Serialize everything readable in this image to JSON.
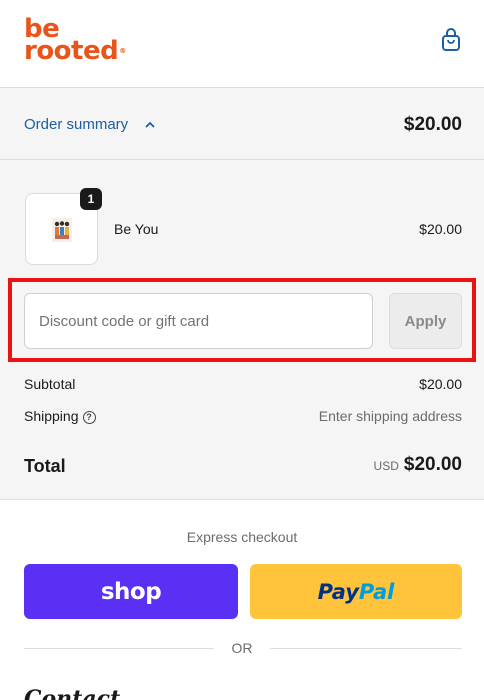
{
  "header": {
    "logo_line1": "be",
    "logo_line2": "rooted",
    "logo_reg": "®",
    "bag_icon": "shopping-bag-icon"
  },
  "order_summary": {
    "toggle_label": "Order summary",
    "toggle_icon": "chevron-up-icon",
    "total": "$20.00",
    "item": {
      "name": "Be You",
      "price": "$20.00",
      "quantity": "1"
    },
    "discount": {
      "placeholder": "Discount code or gift card",
      "value": "",
      "apply_label": "Apply"
    },
    "subtotal_label": "Subtotal",
    "subtotal_value": "$20.00",
    "shipping_label": "Shipping",
    "shipping_help_icon": "question-circle-icon",
    "shipping_value": "Enter shipping address",
    "total_label": "Total",
    "total_currency": "USD",
    "total_value": "$20.00"
  },
  "express": {
    "title": "Express checkout",
    "shop_label": "shop",
    "paypal_part1": "Pay",
    "paypal_part2": "Pal"
  },
  "or_label": "OR",
  "contact_heading": "Contact",
  "colors": {
    "brand": "#e8541a",
    "link": "#1b5fa6",
    "shop": "#5a31f4",
    "paypal": "#ffc439",
    "highlight": "#ec1212"
  }
}
